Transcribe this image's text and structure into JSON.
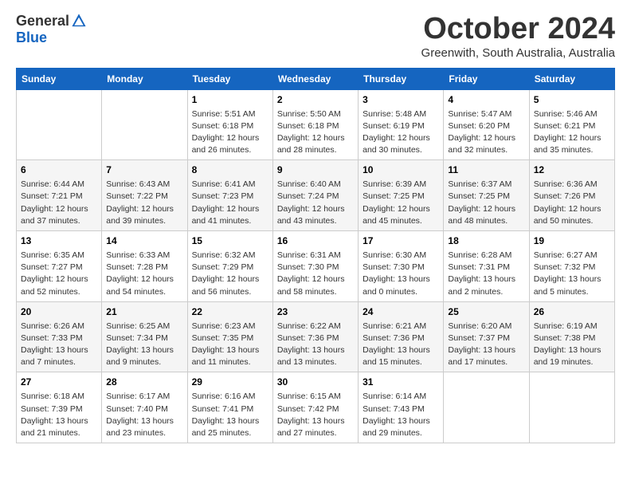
{
  "header": {
    "logo": {
      "general": "General",
      "blue": "Blue"
    },
    "title": "October 2024",
    "subtitle": "Greenwith, South Australia, Australia"
  },
  "days_of_week": [
    "Sunday",
    "Monday",
    "Tuesday",
    "Wednesday",
    "Thursday",
    "Friday",
    "Saturday"
  ],
  "weeks": [
    [
      {
        "day": "",
        "info": ""
      },
      {
        "day": "",
        "info": ""
      },
      {
        "day": "1",
        "sunrise": "Sunrise: 5:51 AM",
        "sunset": "Sunset: 6:18 PM",
        "daylight": "Daylight: 12 hours and 26 minutes."
      },
      {
        "day": "2",
        "sunrise": "Sunrise: 5:50 AM",
        "sunset": "Sunset: 6:18 PM",
        "daylight": "Daylight: 12 hours and 28 minutes."
      },
      {
        "day": "3",
        "sunrise": "Sunrise: 5:48 AM",
        "sunset": "Sunset: 6:19 PM",
        "daylight": "Daylight: 12 hours and 30 minutes."
      },
      {
        "day": "4",
        "sunrise": "Sunrise: 5:47 AM",
        "sunset": "Sunset: 6:20 PM",
        "daylight": "Daylight: 12 hours and 32 minutes."
      },
      {
        "day": "5",
        "sunrise": "Sunrise: 5:46 AM",
        "sunset": "Sunset: 6:21 PM",
        "daylight": "Daylight: 12 hours and 35 minutes."
      }
    ],
    [
      {
        "day": "6",
        "sunrise": "Sunrise: 6:44 AM",
        "sunset": "Sunset: 7:21 PM",
        "daylight": "Daylight: 12 hours and 37 minutes."
      },
      {
        "day": "7",
        "sunrise": "Sunrise: 6:43 AM",
        "sunset": "Sunset: 7:22 PM",
        "daylight": "Daylight: 12 hours and 39 minutes."
      },
      {
        "day": "8",
        "sunrise": "Sunrise: 6:41 AM",
        "sunset": "Sunset: 7:23 PM",
        "daylight": "Daylight: 12 hours and 41 minutes."
      },
      {
        "day": "9",
        "sunrise": "Sunrise: 6:40 AM",
        "sunset": "Sunset: 7:24 PM",
        "daylight": "Daylight: 12 hours and 43 minutes."
      },
      {
        "day": "10",
        "sunrise": "Sunrise: 6:39 AM",
        "sunset": "Sunset: 7:25 PM",
        "daylight": "Daylight: 12 hours and 45 minutes."
      },
      {
        "day": "11",
        "sunrise": "Sunrise: 6:37 AM",
        "sunset": "Sunset: 7:25 PM",
        "daylight": "Daylight: 12 hours and 48 minutes."
      },
      {
        "day": "12",
        "sunrise": "Sunrise: 6:36 AM",
        "sunset": "Sunset: 7:26 PM",
        "daylight": "Daylight: 12 hours and 50 minutes."
      }
    ],
    [
      {
        "day": "13",
        "sunrise": "Sunrise: 6:35 AM",
        "sunset": "Sunset: 7:27 PM",
        "daylight": "Daylight: 12 hours and 52 minutes."
      },
      {
        "day": "14",
        "sunrise": "Sunrise: 6:33 AM",
        "sunset": "Sunset: 7:28 PM",
        "daylight": "Daylight: 12 hours and 54 minutes."
      },
      {
        "day": "15",
        "sunrise": "Sunrise: 6:32 AM",
        "sunset": "Sunset: 7:29 PM",
        "daylight": "Daylight: 12 hours and 56 minutes."
      },
      {
        "day": "16",
        "sunrise": "Sunrise: 6:31 AM",
        "sunset": "Sunset: 7:30 PM",
        "daylight": "Daylight: 12 hours and 58 minutes."
      },
      {
        "day": "17",
        "sunrise": "Sunrise: 6:30 AM",
        "sunset": "Sunset: 7:30 PM",
        "daylight": "Daylight: 13 hours and 0 minutes."
      },
      {
        "day": "18",
        "sunrise": "Sunrise: 6:28 AM",
        "sunset": "Sunset: 7:31 PM",
        "daylight": "Daylight: 13 hours and 2 minutes."
      },
      {
        "day": "19",
        "sunrise": "Sunrise: 6:27 AM",
        "sunset": "Sunset: 7:32 PM",
        "daylight": "Daylight: 13 hours and 5 minutes."
      }
    ],
    [
      {
        "day": "20",
        "sunrise": "Sunrise: 6:26 AM",
        "sunset": "Sunset: 7:33 PM",
        "daylight": "Daylight: 13 hours and 7 minutes."
      },
      {
        "day": "21",
        "sunrise": "Sunrise: 6:25 AM",
        "sunset": "Sunset: 7:34 PM",
        "daylight": "Daylight: 13 hours and 9 minutes."
      },
      {
        "day": "22",
        "sunrise": "Sunrise: 6:23 AM",
        "sunset": "Sunset: 7:35 PM",
        "daylight": "Daylight: 13 hours and 11 minutes."
      },
      {
        "day": "23",
        "sunrise": "Sunrise: 6:22 AM",
        "sunset": "Sunset: 7:36 PM",
        "daylight": "Daylight: 13 hours and 13 minutes."
      },
      {
        "day": "24",
        "sunrise": "Sunrise: 6:21 AM",
        "sunset": "Sunset: 7:36 PM",
        "daylight": "Daylight: 13 hours and 15 minutes."
      },
      {
        "day": "25",
        "sunrise": "Sunrise: 6:20 AM",
        "sunset": "Sunset: 7:37 PM",
        "daylight": "Daylight: 13 hours and 17 minutes."
      },
      {
        "day": "26",
        "sunrise": "Sunrise: 6:19 AM",
        "sunset": "Sunset: 7:38 PM",
        "daylight": "Daylight: 13 hours and 19 minutes."
      }
    ],
    [
      {
        "day": "27",
        "sunrise": "Sunrise: 6:18 AM",
        "sunset": "Sunset: 7:39 PM",
        "daylight": "Daylight: 13 hours and 21 minutes."
      },
      {
        "day": "28",
        "sunrise": "Sunrise: 6:17 AM",
        "sunset": "Sunset: 7:40 PM",
        "daylight": "Daylight: 13 hours and 23 minutes."
      },
      {
        "day": "29",
        "sunrise": "Sunrise: 6:16 AM",
        "sunset": "Sunset: 7:41 PM",
        "daylight": "Daylight: 13 hours and 25 minutes."
      },
      {
        "day": "30",
        "sunrise": "Sunrise: 6:15 AM",
        "sunset": "Sunset: 7:42 PM",
        "daylight": "Daylight: 13 hours and 27 minutes."
      },
      {
        "day": "31",
        "sunrise": "Sunrise: 6:14 AM",
        "sunset": "Sunset: 7:43 PM",
        "daylight": "Daylight: 13 hours and 29 minutes."
      },
      {
        "day": "",
        "info": ""
      },
      {
        "day": "",
        "info": ""
      }
    ]
  ]
}
